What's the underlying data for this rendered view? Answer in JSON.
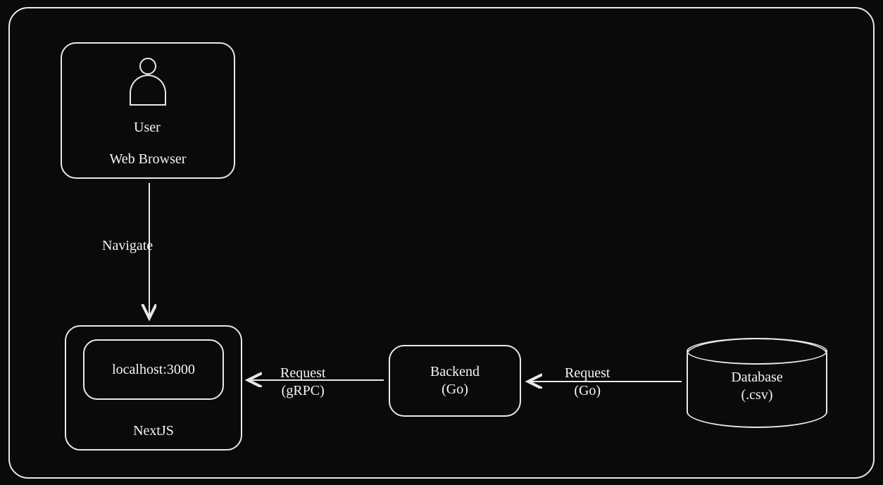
{
  "nodes": {
    "web_browser": {
      "title": "Web Browser",
      "actor": "User"
    },
    "nextjs": {
      "title": "NextJS",
      "inner": "localhost:3000"
    },
    "backend": {
      "line1": "Backend",
      "line2": "(Go)"
    },
    "database": {
      "line1": "Database",
      "line2": "(.csv)"
    }
  },
  "edges": {
    "navigate": {
      "label": "Navigate"
    },
    "req_grpc": {
      "line1": "Request",
      "line2": "(gRPC)"
    },
    "req_go": {
      "line1": "Request",
      "line2": "(Go)"
    }
  }
}
